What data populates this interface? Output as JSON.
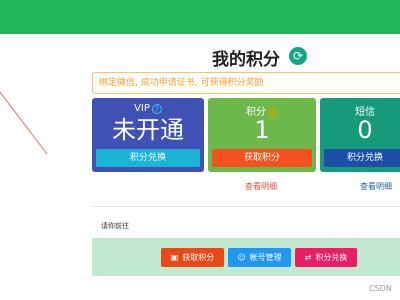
{
  "header": {
    "color": "#1fb75a"
  },
  "page": {
    "title": "我的积分",
    "refresh_icon": "refresh-icon"
  },
  "notice": {
    "text": "绑定微信, 成功申请证书, 可获得积分奖励"
  },
  "cards": {
    "vip": {
      "label": "VIP",
      "value": "未开通",
      "button": "积分兑换",
      "help_icon": "?"
    },
    "points": {
      "label": "积分",
      "value": "1",
      "button": "获取积分",
      "info_icon": "?",
      "detail_link": "查看明细"
    },
    "sms": {
      "label": "短信",
      "value": "0",
      "button": "积分兑换",
      "detail_link": "查看明细"
    }
  },
  "goto": {
    "label": "请你前往",
    "actions": [
      {
        "label": "获取积分",
        "icon": "gift-icon"
      },
      {
        "label": "帐号管理",
        "icon": "user-settings-icon"
      },
      {
        "label": "积分兑换",
        "icon": "exchange-icon"
      }
    ]
  },
  "watermark": "CSDN",
  "colors": {
    "vip_card": "#3f51b5",
    "points_card": "#6cb84a",
    "sms_card": "#159a7c",
    "earn_button": "#e64a19",
    "account_button": "#2196f3",
    "exchange_button": "#e91e63",
    "action_panel": "#c2e9cf"
  }
}
